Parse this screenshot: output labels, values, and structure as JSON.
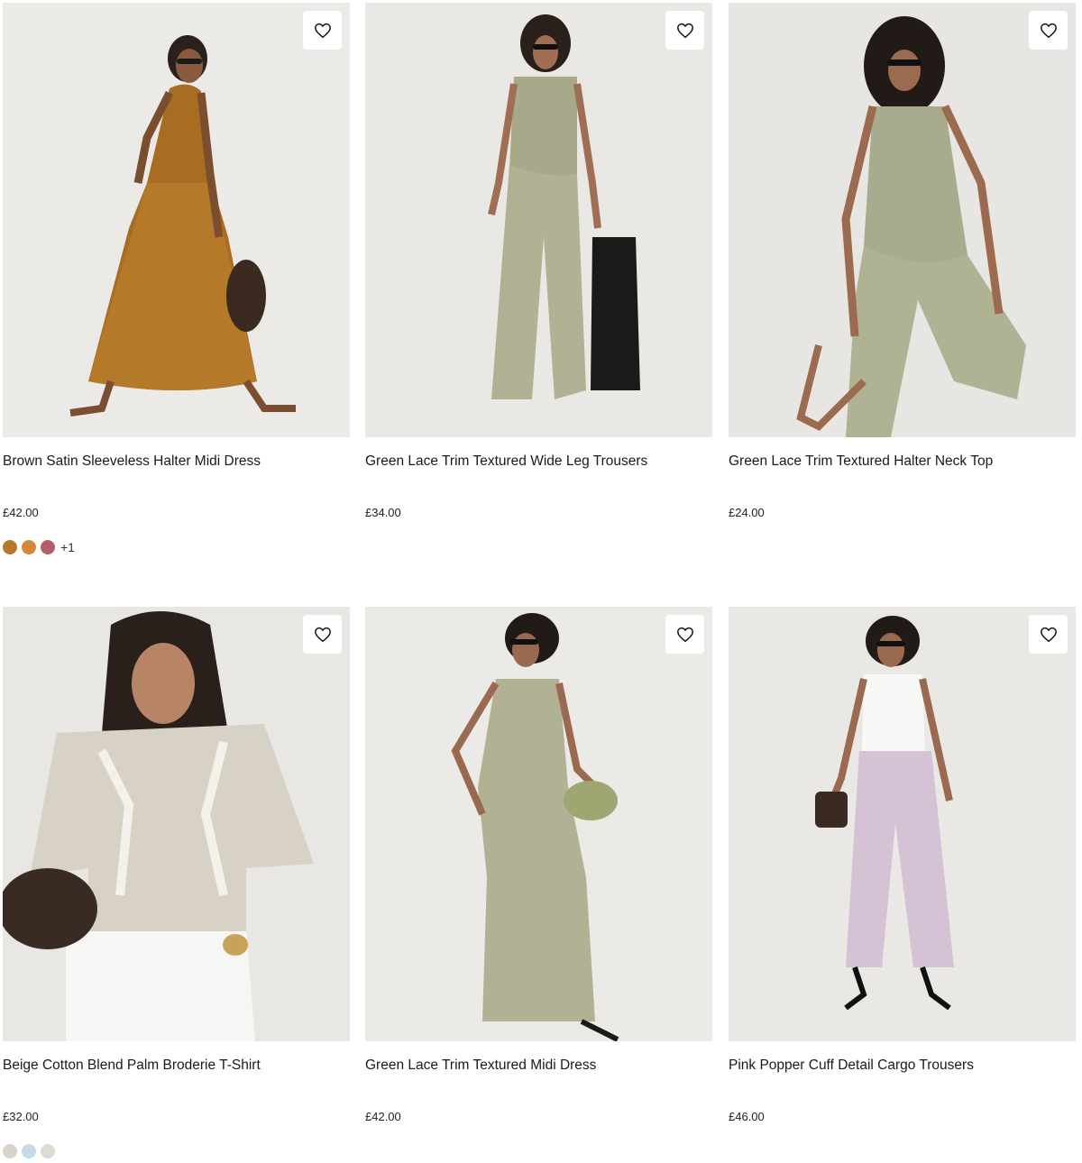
{
  "products": [
    {
      "title": "Brown Satin Sleeveless Halter Midi Dress",
      "price": "£42.00",
      "swatches": [
        "#b4772c",
        "#d08a3a",
        "#b45f67"
      ],
      "more": "+1"
    },
    {
      "title": "Green Lace Trim Textured Wide Leg Trousers",
      "price": "£34.00",
      "swatches": [],
      "more": ""
    },
    {
      "title": "Green Lace Trim Textured Halter Neck Top",
      "price": "£24.00",
      "swatches": [],
      "more": ""
    },
    {
      "title": "Beige Cotton Blend Palm Broderie T-Shirt",
      "price": "£32.00",
      "swatches": [
        "#d8d4c9",
        "#c6dbe8",
        "#dcdcd2"
      ],
      "more": ""
    },
    {
      "title": "Green Lace Trim Textured Midi Dress",
      "price": "£42.00",
      "swatches": [],
      "more": ""
    },
    {
      "title": "Pink Popper Cuff Detail Cargo Trousers",
      "price": "£46.00",
      "swatches": [],
      "more": ""
    }
  ],
  "icons": {
    "wishlist": "heart-outline-icon"
  }
}
